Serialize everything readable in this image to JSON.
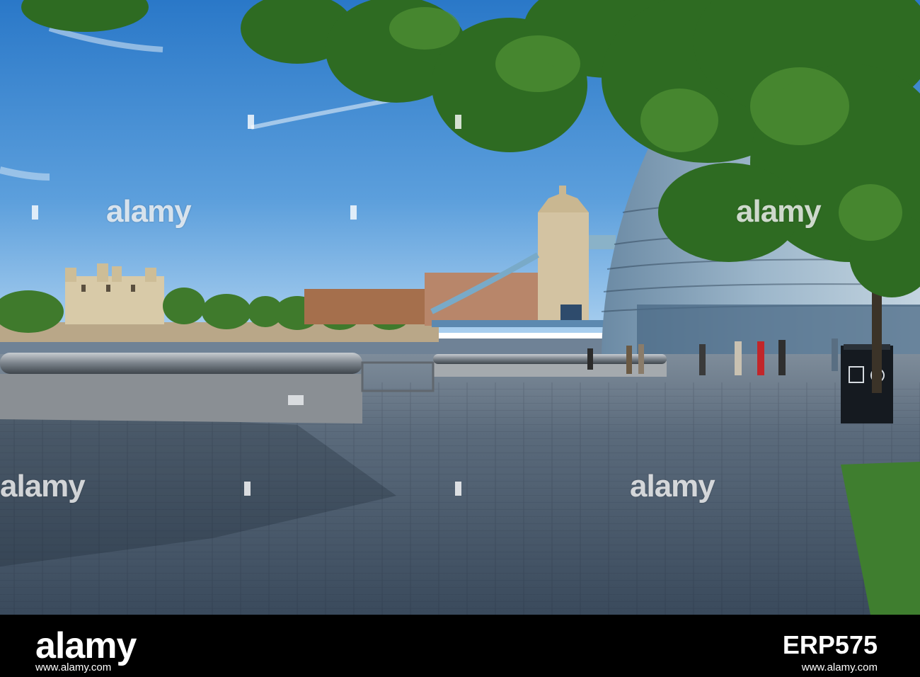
{
  "photo": {
    "alt": "",
    "watermark_text": "alamy"
  },
  "footer": {
    "logo_text": "alamy",
    "image_id": "ERP575",
    "url_left": "www.alamy.com",
    "url_right": "www.alamy.com"
  },
  "colors": {
    "sky_top": "#2f7fcf",
    "sky_bottom": "#9dc8ee",
    "pavement": "#4d5f73",
    "foliage": "#1f5a1f",
    "hedge": "#3f7e2f",
    "strip": "#000000"
  }
}
